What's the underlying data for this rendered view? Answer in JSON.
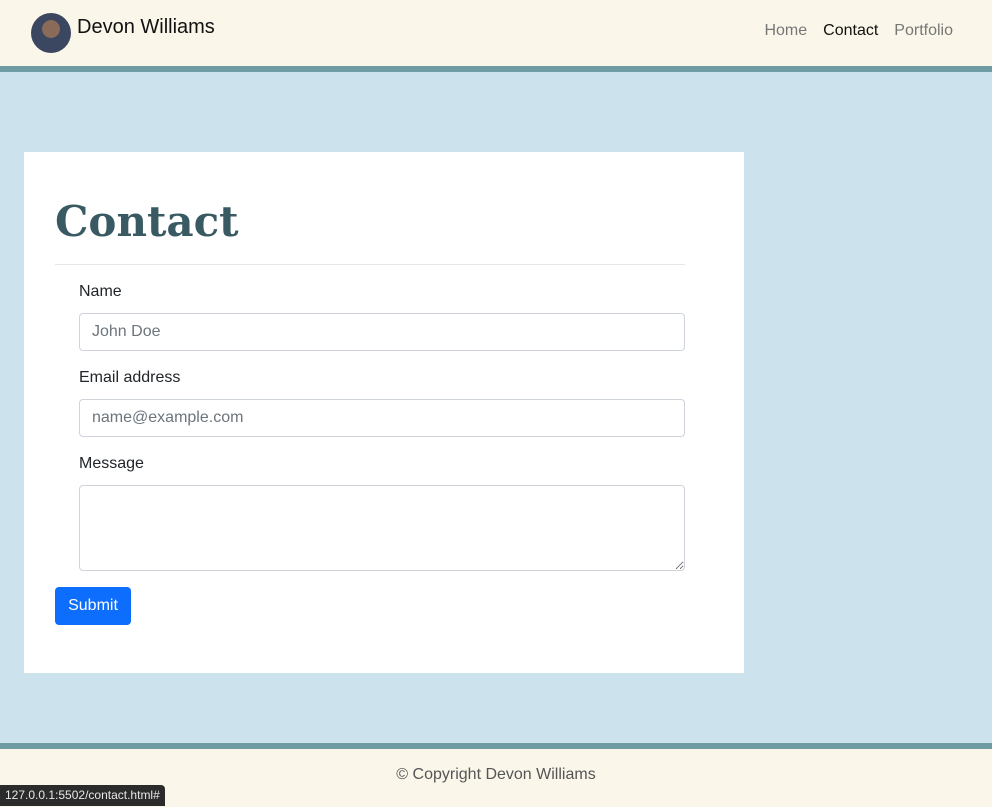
{
  "header": {
    "brand_name": "Devon Williams",
    "nav": [
      {
        "label": "Home"
      },
      {
        "label": "Contact"
      },
      {
        "label": "Portfolio"
      }
    ],
    "active_nav": "Contact"
  },
  "main": {
    "title": "Contact",
    "form": {
      "name_label": "Name",
      "name_placeholder": "John Doe",
      "email_label": "Email address",
      "email_placeholder": "name@example.com",
      "message_label": "Message",
      "message_value": "",
      "submit_label": "Submit"
    }
  },
  "footer": {
    "copyright": "© Copyright Devon Williams"
  },
  "status_bar": {
    "url": "127.0.0.1:5502/contact.html#"
  },
  "colors": {
    "page_background": "#cce3ee",
    "header_background": "#faf6e9",
    "accent_border": "#6f9ba2",
    "title_color": "#3a5a63",
    "button_primary": "#0d6efd"
  },
  "icons": {
    "avatar": "profile-photo"
  }
}
